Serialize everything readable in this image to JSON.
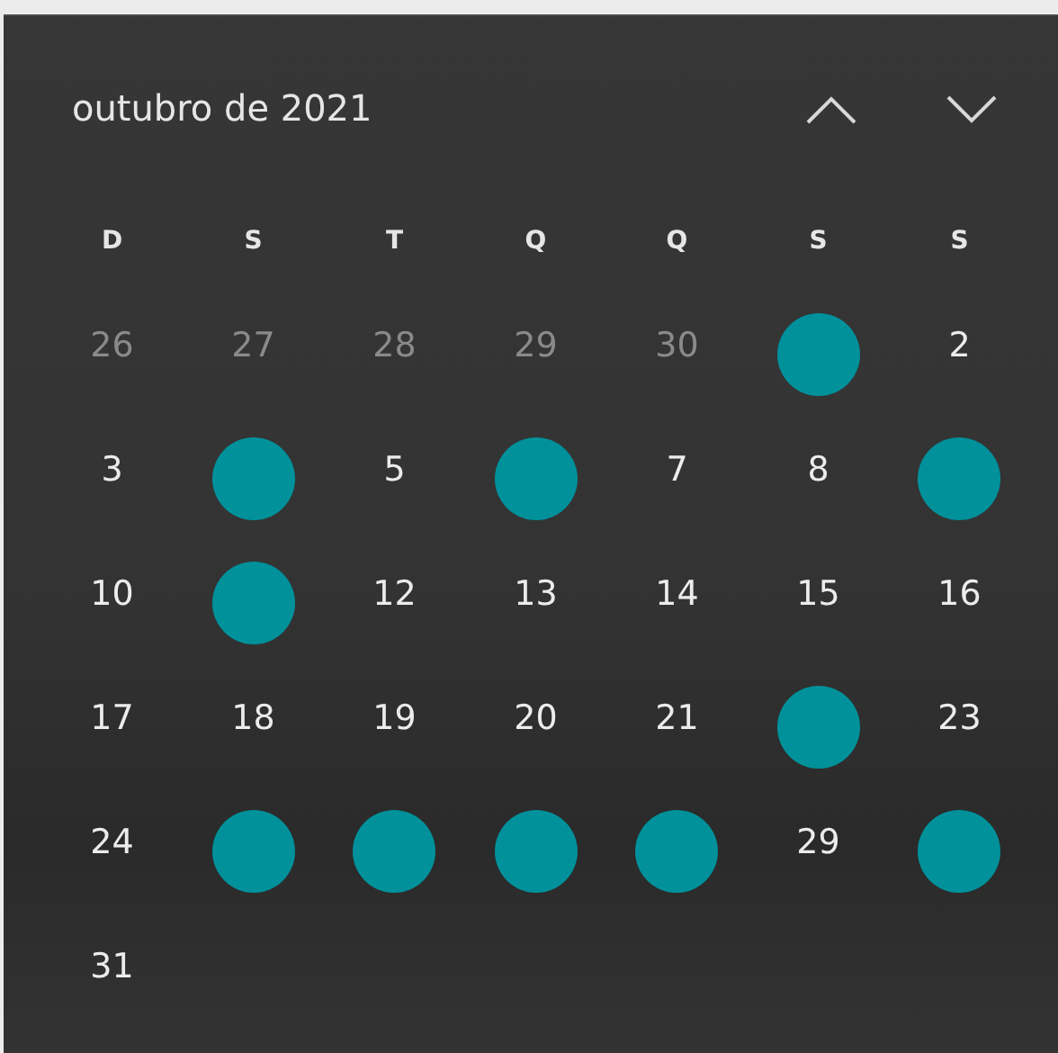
{
  "calendar": {
    "title": "outubro de 2021",
    "weekdays": [
      "D",
      "S",
      "T",
      "Q",
      "Q",
      "S",
      "S"
    ],
    "days": [
      {
        "kind": "other_month",
        "text": "26"
      },
      {
        "kind": "other_month",
        "text": "27"
      },
      {
        "kind": "other_month",
        "text": "28"
      },
      {
        "kind": "other_month",
        "text": "29"
      },
      {
        "kind": "other_month",
        "text": "30"
      },
      {
        "kind": "marked",
        "color": "#00919b"
      },
      {
        "kind": "current",
        "text": "2"
      },
      {
        "kind": "current",
        "text": "3"
      },
      {
        "kind": "marked",
        "color": "#00919b"
      },
      {
        "kind": "current",
        "text": "5"
      },
      {
        "kind": "marked",
        "color": "#00919b"
      },
      {
        "kind": "current",
        "text": "7"
      },
      {
        "kind": "current",
        "text": "8"
      },
      {
        "kind": "marked",
        "color": "#00919b"
      },
      {
        "kind": "current",
        "text": "10"
      },
      {
        "kind": "marked",
        "color": "#00919b"
      },
      {
        "kind": "current",
        "text": "12"
      },
      {
        "kind": "current",
        "text": "13"
      },
      {
        "kind": "current",
        "text": "14"
      },
      {
        "kind": "current",
        "text": "15"
      },
      {
        "kind": "current",
        "text": "16"
      },
      {
        "kind": "current",
        "text": "17"
      },
      {
        "kind": "current",
        "text": "18"
      },
      {
        "kind": "current",
        "text": "19"
      },
      {
        "kind": "current",
        "text": "20"
      },
      {
        "kind": "current",
        "text": "21"
      },
      {
        "kind": "marked",
        "color": "#00919b"
      },
      {
        "kind": "current",
        "text": "23"
      },
      {
        "kind": "current",
        "text": "24"
      },
      {
        "kind": "marked",
        "color": "#00919b"
      },
      {
        "kind": "marked",
        "color": "#00919b"
      },
      {
        "kind": "marked",
        "color": "#00919b"
      },
      {
        "kind": "marked",
        "color": "#00919b"
      },
      {
        "kind": "current",
        "text": "29"
      },
      {
        "kind": "marked",
        "color": "#00919b"
      },
      {
        "kind": "current",
        "text": "31"
      }
    ]
  }
}
